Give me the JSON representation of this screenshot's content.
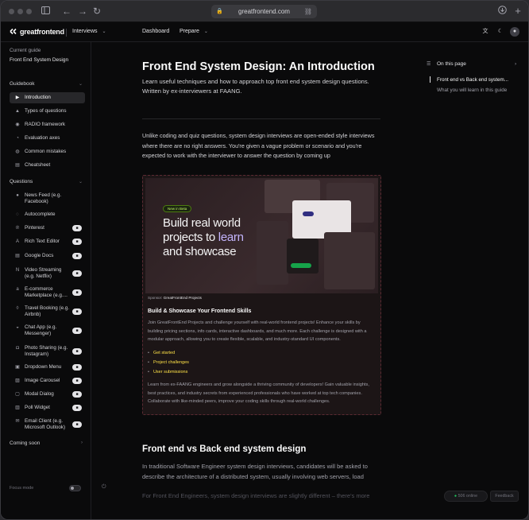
{
  "browser": {
    "url": "greatfrontend.com"
  },
  "topnav": {
    "brand": "greatfrontend",
    "product": "Interviews",
    "links": [
      "Dashboard",
      "Prepare"
    ]
  },
  "sidebar": {
    "current_guide_label": "Current guide",
    "current_guide_value": "Front End System Design",
    "guidebook_label": "Guidebook",
    "guidebook_items": [
      {
        "label": "Introduction",
        "icon": "play-icon",
        "active": true
      },
      {
        "label": "Types of questions",
        "icon": "shapes-icon"
      },
      {
        "label": "RADIO framework",
        "icon": "radio-icon"
      },
      {
        "label": "Evaluation axes",
        "icon": "chart-icon"
      },
      {
        "label": "Common mistakes",
        "icon": "warning-icon"
      },
      {
        "label": "Cheatsheet",
        "icon": "document-icon"
      }
    ],
    "questions_label": "Questions",
    "question_items": [
      {
        "label": "News Feed (e.g. Facebook)",
        "icon": "facebook-icon",
        "locked": false
      },
      {
        "label": "Autocomplete",
        "icon": "autocomplete-icon",
        "locked": false
      },
      {
        "label": "Pinterest",
        "icon": "pinterest-icon",
        "locked": true
      },
      {
        "label": "Rich Text Editor",
        "icon": "text-icon",
        "locked": true
      },
      {
        "label": "Google Docs",
        "icon": "docs-icon",
        "locked": true
      },
      {
        "label": "Video Streaming (e.g. Netflix)",
        "icon": "netflix-icon",
        "locked": true
      },
      {
        "label": "E-commerce Marketplace (e.g....",
        "icon": "amazon-icon",
        "locked": true
      },
      {
        "label": "Travel Booking (e.g. Airbnb)",
        "icon": "airbnb-icon",
        "locked": true
      },
      {
        "label": "Chat App (e.g. Messenger)",
        "icon": "messenger-icon",
        "locked": true
      },
      {
        "label": "Photo Sharing (e.g. Instagram)",
        "icon": "instagram-icon",
        "locked": true
      },
      {
        "label": "Dropdown Menu",
        "icon": "dropdown-icon",
        "locked": true
      },
      {
        "label": "Image Carousel",
        "icon": "image-icon",
        "locked": true
      },
      {
        "label": "Modal Dialog",
        "icon": "modal-icon",
        "locked": true
      },
      {
        "label": "Poll Widget",
        "icon": "poll-icon",
        "locked": true
      },
      {
        "label": "Email Client (e.g. Microsoft Outlook)",
        "icon": "mail-icon",
        "locked": true
      }
    ],
    "coming_soon_label": "Coming soon",
    "focus_mode_label": "Focus mode"
  },
  "main": {
    "title": "Front End System Design: An Introduction",
    "lead": "Learn useful techniques and how to approach top front end system design questions. Written by ex-interviewers at FAANG.",
    "intro_para": "Unlike coding and quiz questions, system design interviews are open-ended style interviews where there are no right answers. You're given a vague problem or scenario and you're expected to work with the interviewer to answer the question by coming up",
    "ad": {
      "pill": "New in Beta",
      "headline_part1": "Build real world projects to ",
      "headline_highlight": "learn",
      "headline_part2": " and showcase",
      "sponsor_label": "Sponsor:",
      "sponsor_name": "GreatFrontEnd Projects",
      "title": "Build & Showcase Your Frontend Skills",
      "body1": "Join GreatFrontEnd Projects and challenge yourself with real-world frontend projects! Enhance your skills by building pricing sections, info cards, interactive dashboards, and much more. Each challenge is designed with a modular approach, allowing you to create flexible, scalable, and industry-standard UI components.",
      "list": [
        "Get started",
        "Project challenges",
        "User submissions"
      ],
      "body2": "Learn from ex-FAANG engineers and grow alongside a thriving community of developers! Gain valuable insights, best practices, and industry secrets from experienced professionals who have worked at top tech companies. Collaborate with like-minded peers, improve your coding skills through real-world challenges."
    },
    "section_title": "Front end vs Back end system design",
    "section_para": "In traditional Software Engineer system design interviews, candidates will be asked to describe the architecture of a distributed system, usually involving web servers, load",
    "section_para2": "For Front End Engineers, system design interviews are slightly different – there's more"
  },
  "rail": {
    "toc_title": "On this page",
    "toc_items": [
      {
        "label": "Front end vs Back end system...",
        "active": true
      },
      {
        "label": "What you will learn in this guide",
        "active": false
      }
    ],
    "online": "506 online",
    "feedback": "Feedback"
  },
  "colors": {
    "accent_yellow": "#fde047",
    "accent_purple": "#c4b5fd",
    "background": "#0a0a0b"
  }
}
